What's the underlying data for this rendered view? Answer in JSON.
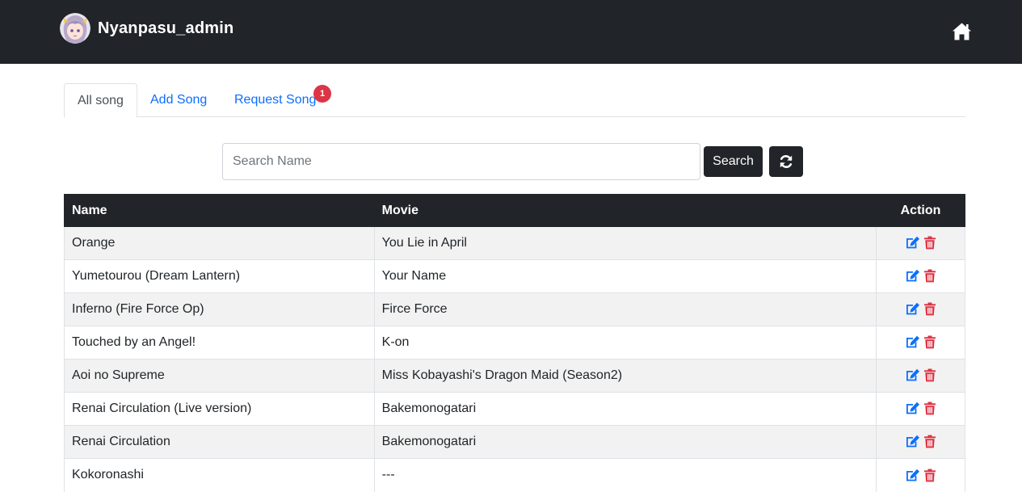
{
  "app": {
    "brand": "Nyanpasu_admin",
    "avatar_icon": "anime-avatar-icon",
    "home_icon": "home-icon"
  },
  "tabs": [
    {
      "label": "All song",
      "active": true
    },
    {
      "label": "Add Song",
      "active": false
    },
    {
      "label": "Request Song",
      "active": false,
      "badge": "1"
    }
  ],
  "search": {
    "placeholder": "Search Name",
    "value": "",
    "button_label": "Search",
    "refresh_icon": "refresh-icon"
  },
  "table": {
    "headers": {
      "name": "Name",
      "movie": "Movie",
      "action": "Action"
    },
    "rows": [
      {
        "name": "Orange",
        "movie": "You Lie in April"
      },
      {
        "name": "Yumetourou (Dream Lantern)",
        "movie": "Your Name"
      },
      {
        "name": "Inferno (Fire Force Op)",
        "movie": "Firce Force"
      },
      {
        "name": "Touched by an Angel!",
        "movie": "K-on"
      },
      {
        "name": "Aoi no Supreme",
        "movie": "Miss Kobayashi's Dragon Maid (Season2)"
      },
      {
        "name": "Renai Circulation (Live version)",
        "movie": "Bakemonogatari"
      },
      {
        "name": "Renai Circulation",
        "movie": "Bakemonogatari"
      },
      {
        "name": "Kokoronashi",
        "movie": "---"
      }
    ],
    "action_icons": [
      "edit-icon",
      "delete-icon"
    ]
  },
  "colors": {
    "navbar": "#212529",
    "link": "#0d6efd",
    "badge": "#dc3545",
    "edit": "#0d6efd",
    "delete": "#dc3545",
    "stripe": "#f2f2f2"
  }
}
